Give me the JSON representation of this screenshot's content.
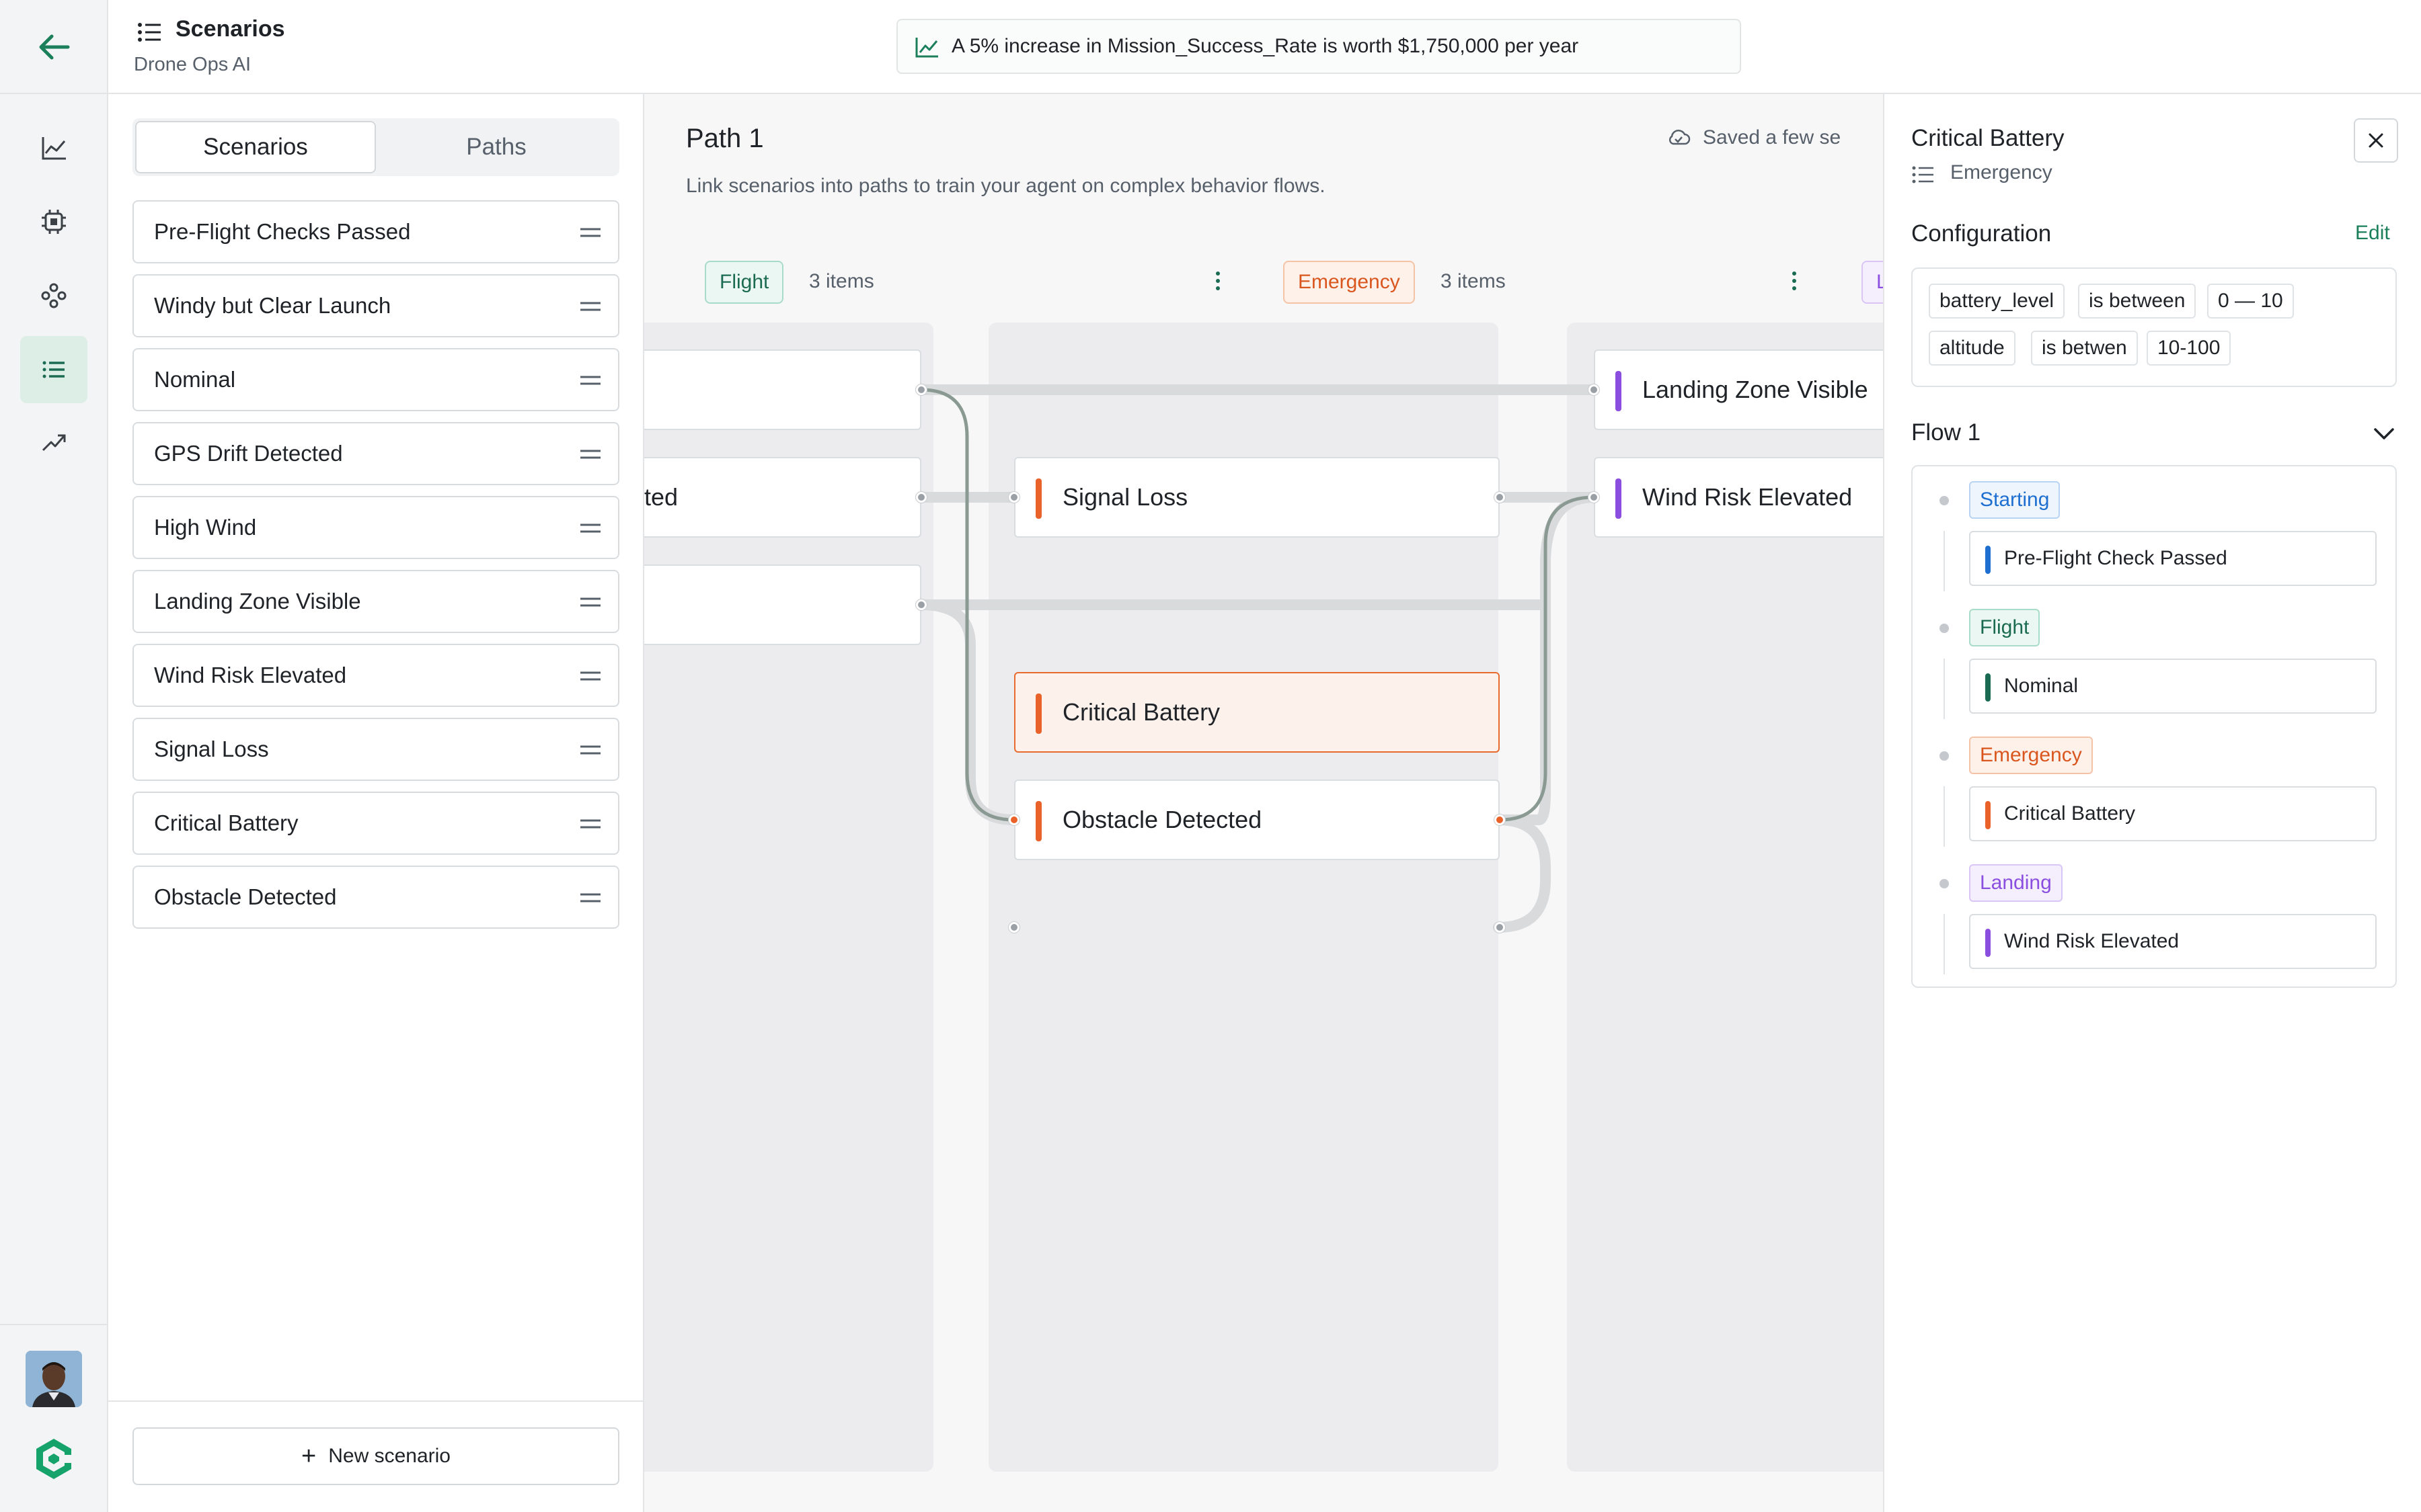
{
  "header": {
    "title": "Scenarios",
    "subtitle": "Drone Ops AI",
    "banner": "A 5% increase in Mission_Success_Rate is worth $1,750,000 per year"
  },
  "sidebar": {
    "tabs": [
      "Scenarios",
      "Paths"
    ],
    "scenarios": [
      "Pre-Flight Checks Passed",
      "Windy but Clear Launch",
      "Nominal",
      "GPS Drift Detected",
      "High Wind",
      "Landing Zone Visible",
      "Wind Risk Elevated",
      "Signal Loss",
      "Critical Battery",
      "Obstacle Detected"
    ],
    "new_scenario": "New scenario"
  },
  "canvas": {
    "path_title": "Path 1",
    "description": "Link scenarios into paths to train your agent on complex behavior flows.",
    "saved": "Saved a few se",
    "columns": [
      {
        "label": "Flight",
        "count": "3 items",
        "cards": [
          "",
          "cted",
          ""
        ]
      },
      {
        "label": "Emergency",
        "count": "3 items",
        "cards": [
          "Signal Loss",
          "Critical Battery",
          "Obstacle Detected"
        ]
      },
      {
        "label": "L",
        "cards": [
          "Landing Zone Visible",
          "Wind Risk Elevated"
        ]
      }
    ]
  },
  "panel": {
    "title": "Critical Battery",
    "subtitle": "Emergency",
    "config_title": "Configuration",
    "edit": "Edit",
    "conditions": [
      {
        "field": "battery_level",
        "op": "is between",
        "value": "0 — 10"
      },
      {
        "field": "altitude",
        "op": "is betwen",
        "value": "10-100"
      }
    ],
    "flow_title": "Flow 1",
    "flow": [
      {
        "stage": "Starting",
        "scenario": "Pre-Flight Check Passed"
      },
      {
        "stage": "Flight",
        "scenario": "Nominal"
      },
      {
        "stage": "Emergency",
        "scenario": "Critical Battery"
      },
      {
        "stage": "Landing",
        "scenario": "Wind Risk Elevated"
      }
    ]
  },
  "colors": {
    "accent_green": "#1a7f5a",
    "flight": "#1b6b52",
    "emergency": "#e8622a",
    "landing": "#8b4fe0",
    "starting": "#1f6fd1"
  }
}
